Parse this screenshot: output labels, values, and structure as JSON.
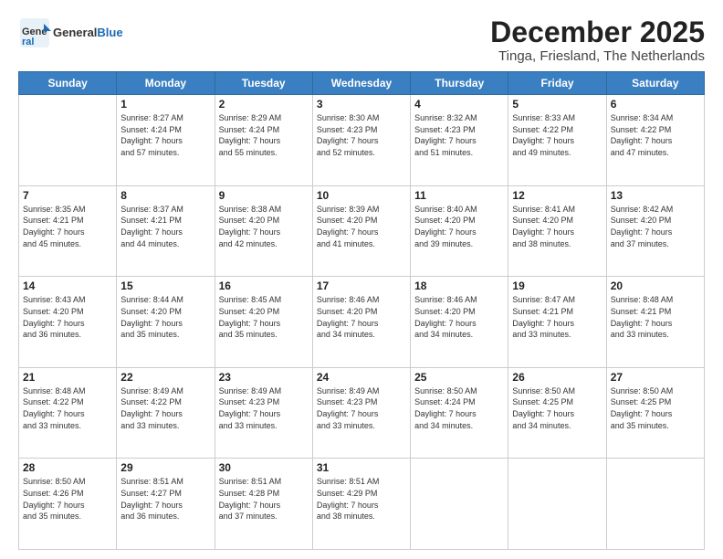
{
  "header": {
    "logo_general": "General",
    "logo_blue": "Blue",
    "title": "December 2025",
    "subtitle": "Tinga, Friesland, The Netherlands"
  },
  "weekdays": [
    "Sunday",
    "Monday",
    "Tuesday",
    "Wednesday",
    "Thursday",
    "Friday",
    "Saturday"
  ],
  "weeks": [
    [
      {
        "day": "",
        "info": ""
      },
      {
        "day": "1",
        "info": "Sunrise: 8:27 AM\nSunset: 4:24 PM\nDaylight: 7 hours\nand 57 minutes."
      },
      {
        "day": "2",
        "info": "Sunrise: 8:29 AM\nSunset: 4:24 PM\nDaylight: 7 hours\nand 55 minutes."
      },
      {
        "day": "3",
        "info": "Sunrise: 8:30 AM\nSunset: 4:23 PM\nDaylight: 7 hours\nand 52 minutes."
      },
      {
        "day": "4",
        "info": "Sunrise: 8:32 AM\nSunset: 4:23 PM\nDaylight: 7 hours\nand 51 minutes."
      },
      {
        "day": "5",
        "info": "Sunrise: 8:33 AM\nSunset: 4:22 PM\nDaylight: 7 hours\nand 49 minutes."
      },
      {
        "day": "6",
        "info": "Sunrise: 8:34 AM\nSunset: 4:22 PM\nDaylight: 7 hours\nand 47 minutes."
      }
    ],
    [
      {
        "day": "7",
        "info": "Sunrise: 8:35 AM\nSunset: 4:21 PM\nDaylight: 7 hours\nand 45 minutes."
      },
      {
        "day": "8",
        "info": "Sunrise: 8:37 AM\nSunset: 4:21 PM\nDaylight: 7 hours\nand 44 minutes."
      },
      {
        "day": "9",
        "info": "Sunrise: 8:38 AM\nSunset: 4:20 PM\nDaylight: 7 hours\nand 42 minutes."
      },
      {
        "day": "10",
        "info": "Sunrise: 8:39 AM\nSunset: 4:20 PM\nDaylight: 7 hours\nand 41 minutes."
      },
      {
        "day": "11",
        "info": "Sunrise: 8:40 AM\nSunset: 4:20 PM\nDaylight: 7 hours\nand 39 minutes."
      },
      {
        "day": "12",
        "info": "Sunrise: 8:41 AM\nSunset: 4:20 PM\nDaylight: 7 hours\nand 38 minutes."
      },
      {
        "day": "13",
        "info": "Sunrise: 8:42 AM\nSunset: 4:20 PM\nDaylight: 7 hours\nand 37 minutes."
      }
    ],
    [
      {
        "day": "14",
        "info": "Sunrise: 8:43 AM\nSunset: 4:20 PM\nDaylight: 7 hours\nand 36 minutes."
      },
      {
        "day": "15",
        "info": "Sunrise: 8:44 AM\nSunset: 4:20 PM\nDaylight: 7 hours\nand 35 minutes."
      },
      {
        "day": "16",
        "info": "Sunrise: 8:45 AM\nSunset: 4:20 PM\nDaylight: 7 hours\nand 35 minutes."
      },
      {
        "day": "17",
        "info": "Sunrise: 8:46 AM\nSunset: 4:20 PM\nDaylight: 7 hours\nand 34 minutes."
      },
      {
        "day": "18",
        "info": "Sunrise: 8:46 AM\nSunset: 4:20 PM\nDaylight: 7 hours\nand 34 minutes."
      },
      {
        "day": "19",
        "info": "Sunrise: 8:47 AM\nSunset: 4:21 PM\nDaylight: 7 hours\nand 33 minutes."
      },
      {
        "day": "20",
        "info": "Sunrise: 8:48 AM\nSunset: 4:21 PM\nDaylight: 7 hours\nand 33 minutes."
      }
    ],
    [
      {
        "day": "21",
        "info": "Sunrise: 8:48 AM\nSunset: 4:22 PM\nDaylight: 7 hours\nand 33 minutes."
      },
      {
        "day": "22",
        "info": "Sunrise: 8:49 AM\nSunset: 4:22 PM\nDaylight: 7 hours\nand 33 minutes."
      },
      {
        "day": "23",
        "info": "Sunrise: 8:49 AM\nSunset: 4:23 PM\nDaylight: 7 hours\nand 33 minutes."
      },
      {
        "day": "24",
        "info": "Sunrise: 8:49 AM\nSunset: 4:23 PM\nDaylight: 7 hours\nand 33 minutes."
      },
      {
        "day": "25",
        "info": "Sunrise: 8:50 AM\nSunset: 4:24 PM\nDaylight: 7 hours\nand 34 minutes."
      },
      {
        "day": "26",
        "info": "Sunrise: 8:50 AM\nSunset: 4:25 PM\nDaylight: 7 hours\nand 34 minutes."
      },
      {
        "day": "27",
        "info": "Sunrise: 8:50 AM\nSunset: 4:25 PM\nDaylight: 7 hours\nand 35 minutes."
      }
    ],
    [
      {
        "day": "28",
        "info": "Sunrise: 8:50 AM\nSunset: 4:26 PM\nDaylight: 7 hours\nand 35 minutes."
      },
      {
        "day": "29",
        "info": "Sunrise: 8:51 AM\nSunset: 4:27 PM\nDaylight: 7 hours\nand 36 minutes."
      },
      {
        "day": "30",
        "info": "Sunrise: 8:51 AM\nSunset: 4:28 PM\nDaylight: 7 hours\nand 37 minutes."
      },
      {
        "day": "31",
        "info": "Sunrise: 8:51 AM\nSunset: 4:29 PM\nDaylight: 7 hours\nand 38 minutes."
      },
      {
        "day": "",
        "info": ""
      },
      {
        "day": "",
        "info": ""
      },
      {
        "day": "",
        "info": ""
      }
    ]
  ]
}
